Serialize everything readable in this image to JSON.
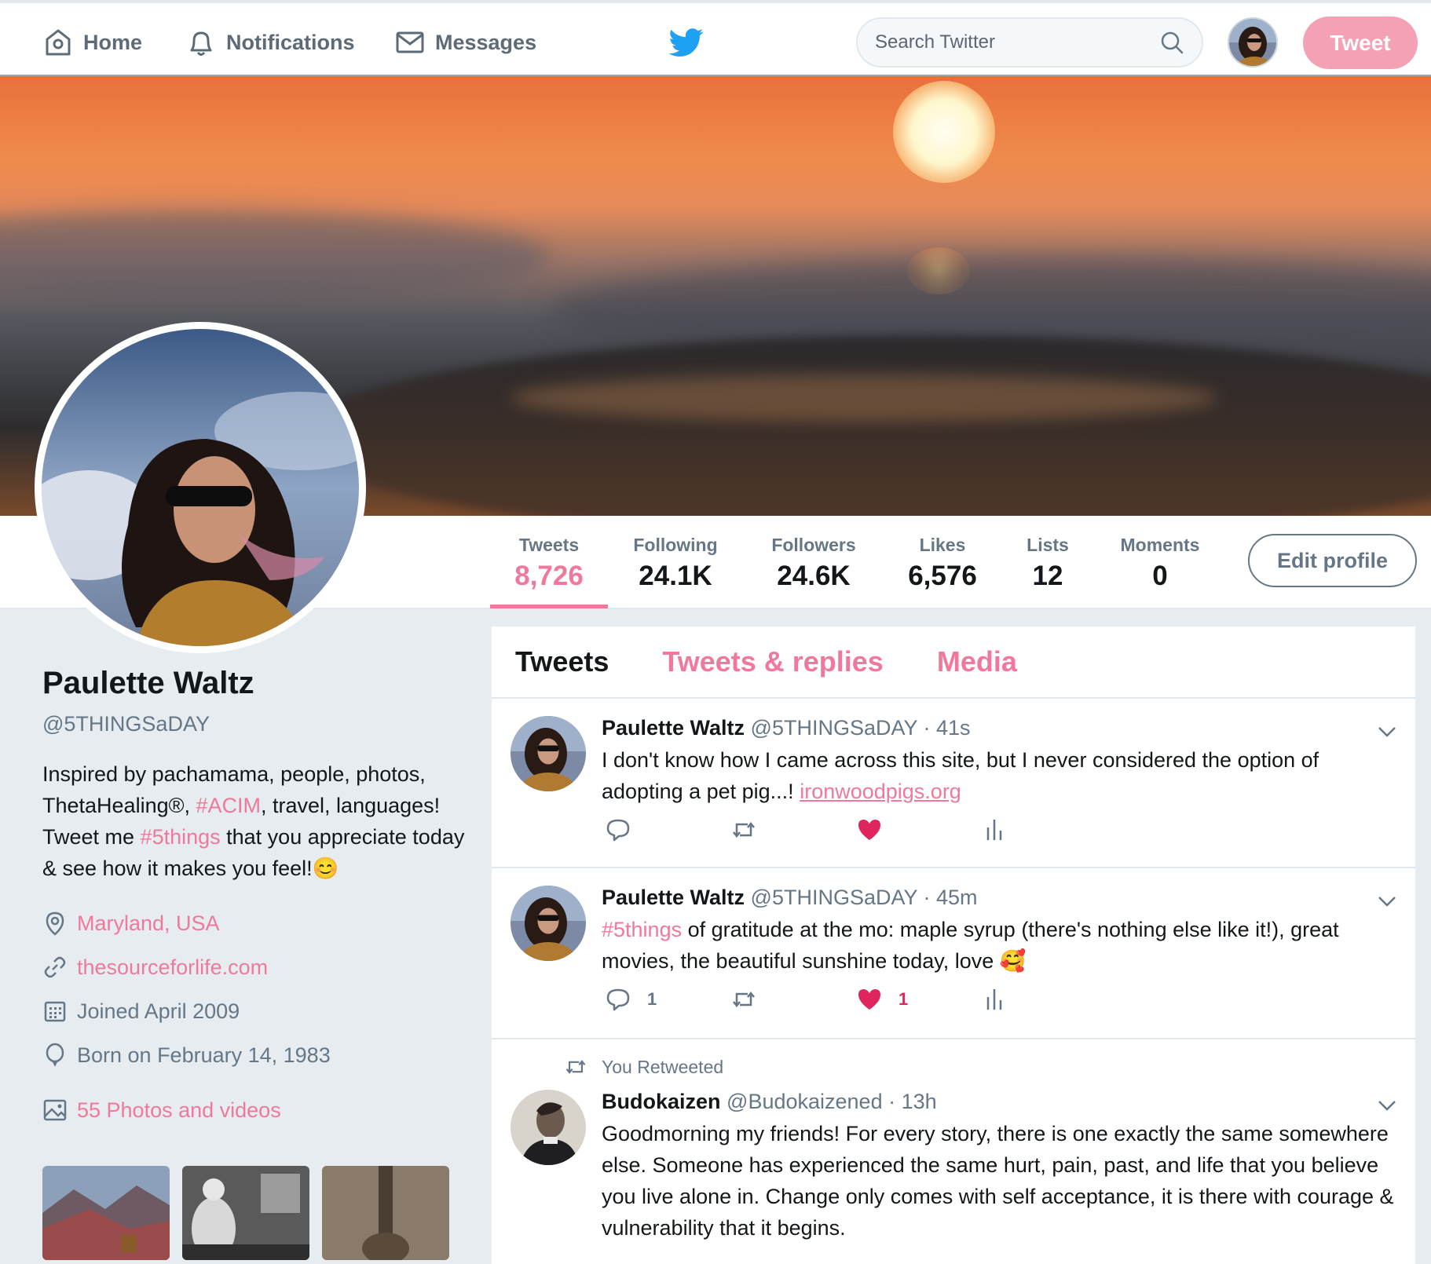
{
  "nav": {
    "home": "Home",
    "notifications": "Notifications",
    "messages": "Messages",
    "search_placeholder": "Search Twitter",
    "tweet_button": "Tweet"
  },
  "colors": {
    "accent": "#f0799b",
    "tweet_button_bg": "#f4a1b6",
    "twitter_blue": "#1da1f2",
    "like_red": "#e0245e"
  },
  "stats": [
    {
      "label": "Tweets",
      "value": "8,726",
      "active": true
    },
    {
      "label": "Following",
      "value": "24.1K"
    },
    {
      "label": "Followers",
      "value": "24.6K"
    },
    {
      "label": "Likes",
      "value": "6,576"
    },
    {
      "label": "Lists",
      "value": "12"
    },
    {
      "label": "Moments",
      "value": "0"
    }
  ],
  "edit_profile": "Edit profile",
  "profile": {
    "name": "Paulette Waltz",
    "handle": "@5THINGSaDAY",
    "bio": {
      "part1": "Inspired by pachamama, people, photos, ThetaHealing®, ",
      "tag1": "#ACIM",
      "part2": ", travel, languages! Tweet me ",
      "tag2": "#5things",
      "part3": " that you appreciate today & see how it makes you feel!",
      "emoji": "😊"
    },
    "location": "Maryland, USA",
    "website": "thesourceforlife.com",
    "joined": "Joined April 2009",
    "born": "Born on February 14, 1983",
    "photos_label": "55 Photos and videos"
  },
  "timeline": {
    "tabs": [
      "Tweets",
      "Tweets & replies",
      "Media"
    ],
    "tweets": [
      {
        "name": "Paulette Waltz",
        "handle": "@5THINGSaDAY",
        "time": "· 41s",
        "text": "I don't know how I came across this site, but I never considered the option of adopting a pet pig...! ",
        "link": "ironwoodpigs.org",
        "replies": "",
        "likes": ""
      },
      {
        "name": "Paulette Waltz",
        "handle": "@5THINGSaDAY",
        "time": "· 45m",
        "tag": "#5things",
        "text": " of gratitude at the mo: maple syrup (there's nothing else like it!), great movies, the beautiful sunshine today, love ",
        "emoji": "🥰",
        "replies": "1",
        "likes": "1"
      },
      {
        "retweet_note": "You Retweeted",
        "name": "Budokaizen",
        "handle": "@Budokaizened",
        "time": "· 13h",
        "text": "Goodmorning my friends! For every story, there is one exactly the same somewhere else. Someone has experienced the same hurt, pain, past, and life that you believe you live alone in. Change only comes with self acceptance, it is there with courage & vulnerability that it begins."
      }
    ]
  }
}
